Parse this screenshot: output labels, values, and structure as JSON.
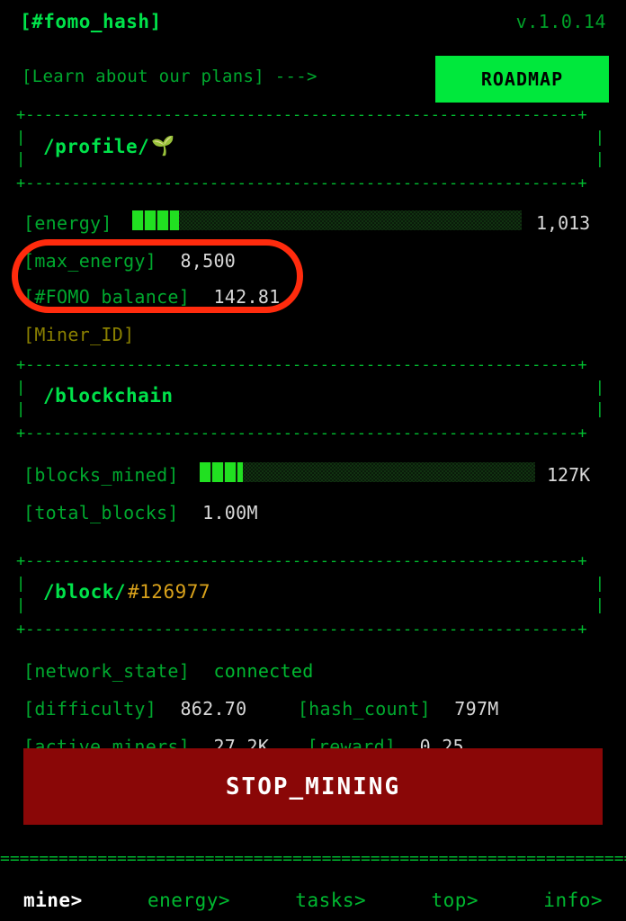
{
  "header": {
    "title": "[#fomo_hash]",
    "version": "v.1.0.14"
  },
  "promo": {
    "learn_text": "[Learn about our plans] --->",
    "roadmap_label": "ROADMAP"
  },
  "panels": {
    "profile": {
      "title": "/profile/",
      "icon": "seedling",
      "icon_glyph": "🌱",
      "rows": [
        {
          "label": "[energy]",
          "value": "1,013",
          "bar": true,
          "fill_pct": 12
        },
        {
          "label": "[max_energy]",
          "value": "8,500"
        },
        {
          "label": "[#FOMO_balance]",
          "value": "142.81"
        },
        {
          "label": "[Miner_ID]",
          "value": ""
        }
      ]
    },
    "blockchain": {
      "title": "/blockchain",
      "rows": [
        {
          "label": "[blocks_mined]",
          "value": "127K",
          "bar": true,
          "fill_pct": 13
        },
        {
          "label": "[total_blocks]",
          "value": "1.00M"
        }
      ]
    },
    "block": {
      "title": "/block/",
      "block_number": "#126977",
      "rows": [
        {
          "label": "[network_state]",
          "value": "connected"
        },
        {
          "label": "[difficulty]",
          "value": "862.70",
          "label2": "[hash_count]",
          "value2": "797M"
        },
        {
          "label": "[active_miners]",
          "value": "27.2K",
          "label2": "[reward]",
          "value2": "0.25"
        }
      ]
    }
  },
  "action": {
    "stop_mining_label": "STOP_MINING"
  },
  "nav": {
    "divider": "==============================================================================================",
    "items": [
      {
        "label": "mine>",
        "active": true
      },
      {
        "label": "energy>",
        "active": false
      },
      {
        "label": "tasks>",
        "active": false
      },
      {
        "label": "top>",
        "active": false
      },
      {
        "label": "info>",
        "active": false
      }
    ]
  },
  "ascii": {
    "horizontal": "+------------------------------------------------------------+",
    "vertical": "|"
  },
  "colors": {
    "background": "#000000",
    "accent_green": "#00e24a",
    "label_green": "#00a82e",
    "value_gray": "#d8d8d8",
    "roadmap_bg": "#00e83c",
    "stop_bg": "#8a0707",
    "annotation_red": "#ff2b0d",
    "block_number_gold": "#d9a21b",
    "miner_id_olive": "#8a8000"
  }
}
